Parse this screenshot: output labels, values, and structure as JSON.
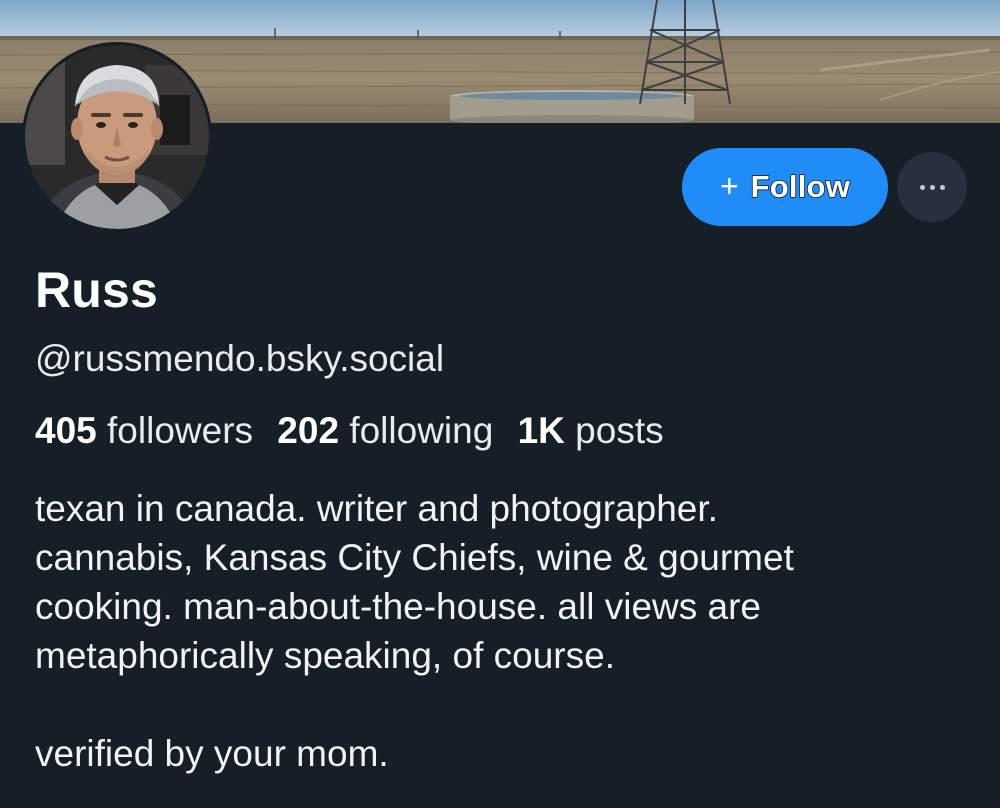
{
  "profile": {
    "display_name": "Russ",
    "handle": "@russmendo.bsky.social",
    "stats": {
      "followers_count": "405",
      "followers_label": "followers",
      "following_count": "202",
      "following_label": "following",
      "posts_count": "1K",
      "posts_label": "posts"
    },
    "bio_lines": [
      "texan in canada. writer and photographer.",
      "cannabis, Kansas City Chiefs, wine & gourmet",
      "cooking. man-about-the-house. all views are",
      "metaphorically speaking, of course.",
      "",
      "verified by your mom."
    ]
  },
  "actions": {
    "follow_icon": "plus-icon",
    "follow_label": "Follow",
    "more_icon": "ellipsis-icon"
  },
  "colors": {
    "background": "#161e27",
    "accent": "#1f8cf8",
    "more_button": "#27303c"
  }
}
